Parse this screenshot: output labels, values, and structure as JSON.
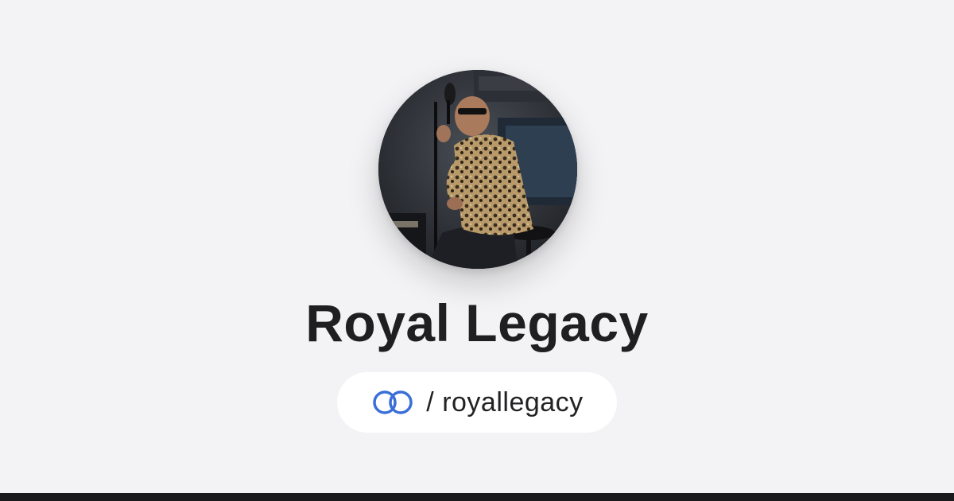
{
  "profile": {
    "name": "Royal Legacy",
    "slash": "/",
    "handle": "royallegacy",
    "avatar_icon": "profile-photo",
    "logo_icon": "linked-rings-icon"
  },
  "colors": {
    "background": "#f3f3f5",
    "pill": "#ffffff",
    "logo_blue": "#3b6fd8",
    "name_text": "#1f1f21",
    "bottom_bar": "#1a1a1c"
  }
}
